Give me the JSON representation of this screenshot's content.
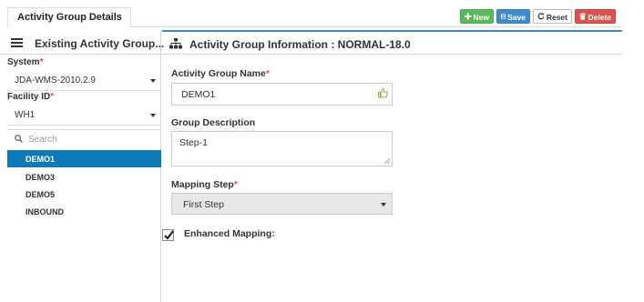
{
  "header": {
    "tab_label": "Activity Group Details",
    "buttons": {
      "new": "New",
      "save": "Save",
      "reset": "Reset",
      "delete": "Delete"
    }
  },
  "left_panel": {
    "title": "Existing Activity Group...",
    "system_label": "System",
    "system_value": "JDA-WMS-2010.2.9",
    "facility_label": "Facility ID",
    "facility_value": "WH1",
    "search_placeholder": "Search",
    "items": [
      {
        "label": "DEMO1",
        "selected": true
      },
      {
        "label": "DEMO3",
        "selected": false
      },
      {
        "label": "DEMO5",
        "selected": false
      },
      {
        "label": "INBOUND",
        "selected": false
      }
    ]
  },
  "right_panel": {
    "title": "Activity Group Information : NORMAL-18.0",
    "group_name_label": "Activity Group Name",
    "group_name_value": "DEMO1",
    "description_label": "Group Description",
    "description_value": "Step-1",
    "mapping_step_label": "Mapping Step",
    "mapping_step_value": "First Step",
    "enhanced_mapping_label": "Enhanced Mapping:",
    "enhanced_mapping_checked": true
  },
  "required_marker": "*",
  "colors": {
    "accent": "#0e7bb8",
    "new": "#5cb85c",
    "save": "#428bca",
    "delete": "#d9534f",
    "required": "#d9534f"
  }
}
